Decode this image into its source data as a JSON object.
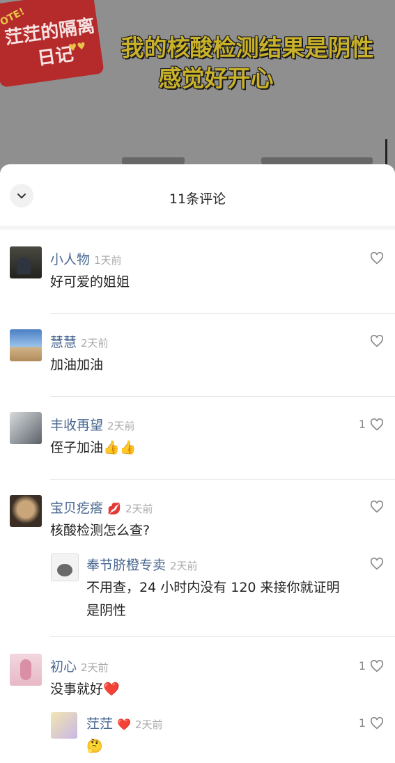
{
  "video": {
    "sticker_tag": "OTE!",
    "sticker_line1": "茳茳的隔离",
    "sticker_line2": "日记",
    "sticker_hearts": "♥♥",
    "headline_line1": "我的核酸检测结果是阴性",
    "headline_line2": "感觉好开心"
  },
  "sheet": {
    "title": "11条评论"
  },
  "comments": [
    {
      "name": "小人物",
      "time": "1天前",
      "text": "好可爱的姐姐",
      "likes": ""
    },
    {
      "name": "慧慧",
      "time": "2天前",
      "text": "加油加油",
      "likes": ""
    },
    {
      "name": "丰收再望",
      "time": "2天前",
      "text": "侄子加油👍👍",
      "likes": "1"
    },
    {
      "name": "宝贝疙瘩",
      "name_emoji": "💋",
      "time": "2天前",
      "text": "核酸检测怎么查?",
      "likes": "",
      "reply": {
        "name": "奉节脐橙专卖",
        "time": "2天前",
        "text_line1": "不用查，24 小时内没有 120 来接你就证明",
        "text_line2": "是阴性",
        "likes": ""
      }
    },
    {
      "name": "初心",
      "time": "2天前",
      "text": "没事就好❤️",
      "likes": "1",
      "reply": {
        "name": "茳茳",
        "name_emoji": "❤️",
        "time": "2天前",
        "text": "🤔",
        "likes": "1"
      }
    }
  ],
  "colors": {
    "username": "#4a6891",
    "timestamp": "#aaaaaa",
    "sticker": "#b52a2a",
    "headline": "#c9b22a"
  },
  "icons": {
    "collapse": "chevron-down-icon",
    "like": "heart-outline-icon"
  }
}
